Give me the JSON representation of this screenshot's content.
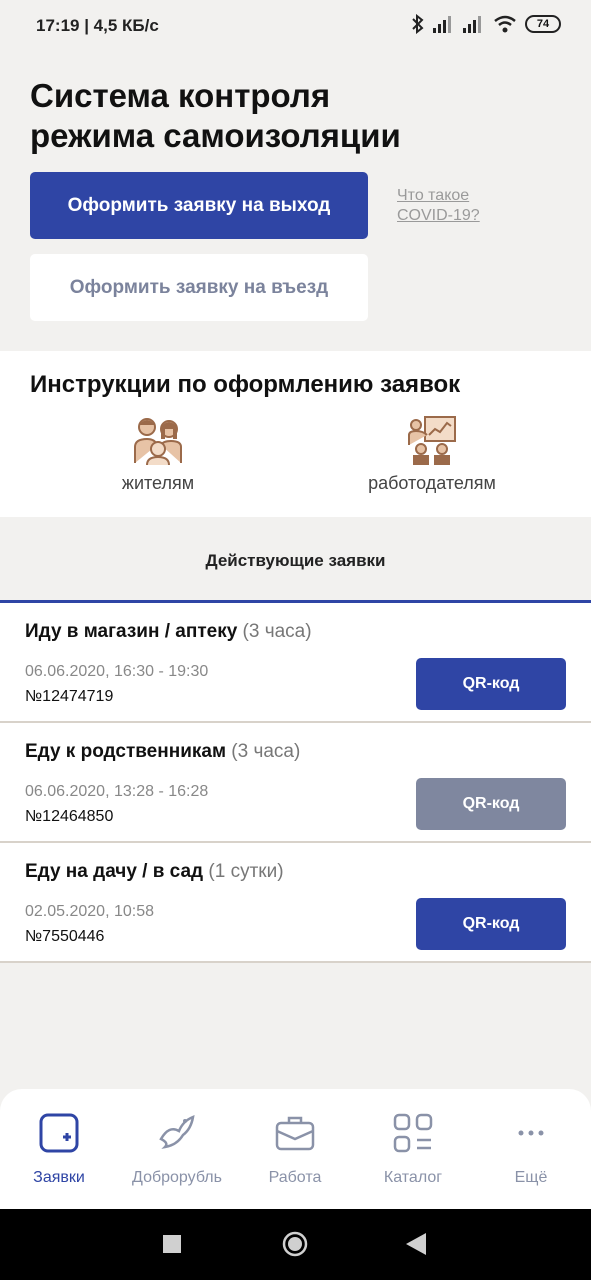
{
  "status_bar": {
    "time_speed": "17:19 | 4,5 КБ/с",
    "battery": "74"
  },
  "header": {
    "title": "Система контроля режима самоизоляции",
    "exit_button": "Оформить заявку на выход",
    "entry_button": "Оформить заявку на въезд",
    "covid_link": "Что такое COVID-19?"
  },
  "instructions": {
    "title": "Инструкции по оформлению заявок",
    "residents": "жителям",
    "employers": "работодателям"
  },
  "tab": {
    "label": "Действующие заявки"
  },
  "requests": [
    {
      "title": "Иду в магазин / аптеку",
      "duration": "(3 часа)",
      "time": "06.06.2020, 16:30 - 19:30",
      "number": "№12474719",
      "qr_label": "QR-код",
      "qr_active": true
    },
    {
      "title": "Еду к родственникам",
      "duration": "(3 часа)",
      "time": "06.06.2020, 13:28 - 16:28",
      "number": "№12464850",
      "qr_label": "QR-код",
      "qr_active": false
    },
    {
      "title": "Еду на дачу / в сад",
      "duration": "(1 сутки)",
      "time": "02.05.2020, 10:58",
      "number": "№7550446",
      "qr_label": "QR-код",
      "qr_active": true
    }
  ],
  "bottom_nav": {
    "items": [
      {
        "label": "Заявки",
        "icon": "requests-icon",
        "active": true
      },
      {
        "label": "Доброрубль",
        "icon": "dove-icon",
        "active": false
      },
      {
        "label": "Работа",
        "icon": "briefcase-icon",
        "active": false
      },
      {
        "label": "Каталог",
        "icon": "catalog-icon",
        "active": false
      },
      {
        "label": "Ещё",
        "icon": "more-icon",
        "active": false
      }
    ]
  },
  "colors": {
    "primary": "#2f45a5",
    "disabled": "#7f879f",
    "background": "#f2f1ef",
    "icon_brown": "#9b6a4a"
  }
}
